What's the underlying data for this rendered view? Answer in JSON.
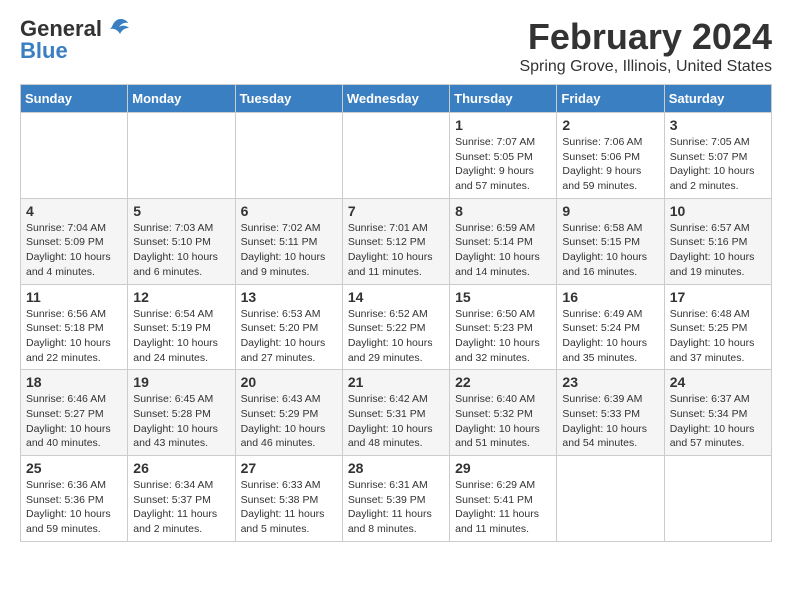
{
  "app": {
    "logo_general": "General",
    "logo_blue": "Blue",
    "month": "February 2024",
    "location": "Spring Grove, Illinois, United States"
  },
  "calendar": {
    "headers": [
      "Sunday",
      "Monday",
      "Tuesday",
      "Wednesday",
      "Thursday",
      "Friday",
      "Saturday"
    ],
    "rows": [
      [
        {
          "day": "",
          "info": ""
        },
        {
          "day": "",
          "info": ""
        },
        {
          "day": "",
          "info": ""
        },
        {
          "day": "",
          "info": ""
        },
        {
          "day": "1",
          "info": "Sunrise: 7:07 AM\nSunset: 5:05 PM\nDaylight: 9 hours\nand 57 minutes."
        },
        {
          "day": "2",
          "info": "Sunrise: 7:06 AM\nSunset: 5:06 PM\nDaylight: 9 hours\nand 59 minutes."
        },
        {
          "day": "3",
          "info": "Sunrise: 7:05 AM\nSunset: 5:07 PM\nDaylight: 10 hours\nand 2 minutes."
        }
      ],
      [
        {
          "day": "4",
          "info": "Sunrise: 7:04 AM\nSunset: 5:09 PM\nDaylight: 10 hours\nand 4 minutes."
        },
        {
          "day": "5",
          "info": "Sunrise: 7:03 AM\nSunset: 5:10 PM\nDaylight: 10 hours\nand 6 minutes."
        },
        {
          "day": "6",
          "info": "Sunrise: 7:02 AM\nSunset: 5:11 PM\nDaylight: 10 hours\nand 9 minutes."
        },
        {
          "day": "7",
          "info": "Sunrise: 7:01 AM\nSunset: 5:12 PM\nDaylight: 10 hours\nand 11 minutes."
        },
        {
          "day": "8",
          "info": "Sunrise: 6:59 AM\nSunset: 5:14 PM\nDaylight: 10 hours\nand 14 minutes."
        },
        {
          "day": "9",
          "info": "Sunrise: 6:58 AM\nSunset: 5:15 PM\nDaylight: 10 hours\nand 16 minutes."
        },
        {
          "day": "10",
          "info": "Sunrise: 6:57 AM\nSunset: 5:16 PM\nDaylight: 10 hours\nand 19 minutes."
        }
      ],
      [
        {
          "day": "11",
          "info": "Sunrise: 6:56 AM\nSunset: 5:18 PM\nDaylight: 10 hours\nand 22 minutes."
        },
        {
          "day": "12",
          "info": "Sunrise: 6:54 AM\nSunset: 5:19 PM\nDaylight: 10 hours\nand 24 minutes."
        },
        {
          "day": "13",
          "info": "Sunrise: 6:53 AM\nSunset: 5:20 PM\nDaylight: 10 hours\nand 27 minutes."
        },
        {
          "day": "14",
          "info": "Sunrise: 6:52 AM\nSunset: 5:22 PM\nDaylight: 10 hours\nand 29 minutes."
        },
        {
          "day": "15",
          "info": "Sunrise: 6:50 AM\nSunset: 5:23 PM\nDaylight: 10 hours\nand 32 minutes."
        },
        {
          "day": "16",
          "info": "Sunrise: 6:49 AM\nSunset: 5:24 PM\nDaylight: 10 hours\nand 35 minutes."
        },
        {
          "day": "17",
          "info": "Sunrise: 6:48 AM\nSunset: 5:25 PM\nDaylight: 10 hours\nand 37 minutes."
        }
      ],
      [
        {
          "day": "18",
          "info": "Sunrise: 6:46 AM\nSunset: 5:27 PM\nDaylight: 10 hours\nand 40 minutes."
        },
        {
          "day": "19",
          "info": "Sunrise: 6:45 AM\nSunset: 5:28 PM\nDaylight: 10 hours\nand 43 minutes."
        },
        {
          "day": "20",
          "info": "Sunrise: 6:43 AM\nSunset: 5:29 PM\nDaylight: 10 hours\nand 46 minutes."
        },
        {
          "day": "21",
          "info": "Sunrise: 6:42 AM\nSunset: 5:31 PM\nDaylight: 10 hours\nand 48 minutes."
        },
        {
          "day": "22",
          "info": "Sunrise: 6:40 AM\nSunset: 5:32 PM\nDaylight: 10 hours\nand 51 minutes."
        },
        {
          "day": "23",
          "info": "Sunrise: 6:39 AM\nSunset: 5:33 PM\nDaylight: 10 hours\nand 54 minutes."
        },
        {
          "day": "24",
          "info": "Sunrise: 6:37 AM\nSunset: 5:34 PM\nDaylight: 10 hours\nand 57 minutes."
        }
      ],
      [
        {
          "day": "25",
          "info": "Sunrise: 6:36 AM\nSunset: 5:36 PM\nDaylight: 10 hours\nand 59 minutes."
        },
        {
          "day": "26",
          "info": "Sunrise: 6:34 AM\nSunset: 5:37 PM\nDaylight: 11 hours\nand 2 minutes."
        },
        {
          "day": "27",
          "info": "Sunrise: 6:33 AM\nSunset: 5:38 PM\nDaylight: 11 hours\nand 5 minutes."
        },
        {
          "day": "28",
          "info": "Sunrise: 6:31 AM\nSunset: 5:39 PM\nDaylight: 11 hours\nand 8 minutes."
        },
        {
          "day": "29",
          "info": "Sunrise: 6:29 AM\nSunset: 5:41 PM\nDaylight: 11 hours\nand 11 minutes."
        },
        {
          "day": "",
          "info": ""
        },
        {
          "day": "",
          "info": ""
        }
      ]
    ]
  }
}
